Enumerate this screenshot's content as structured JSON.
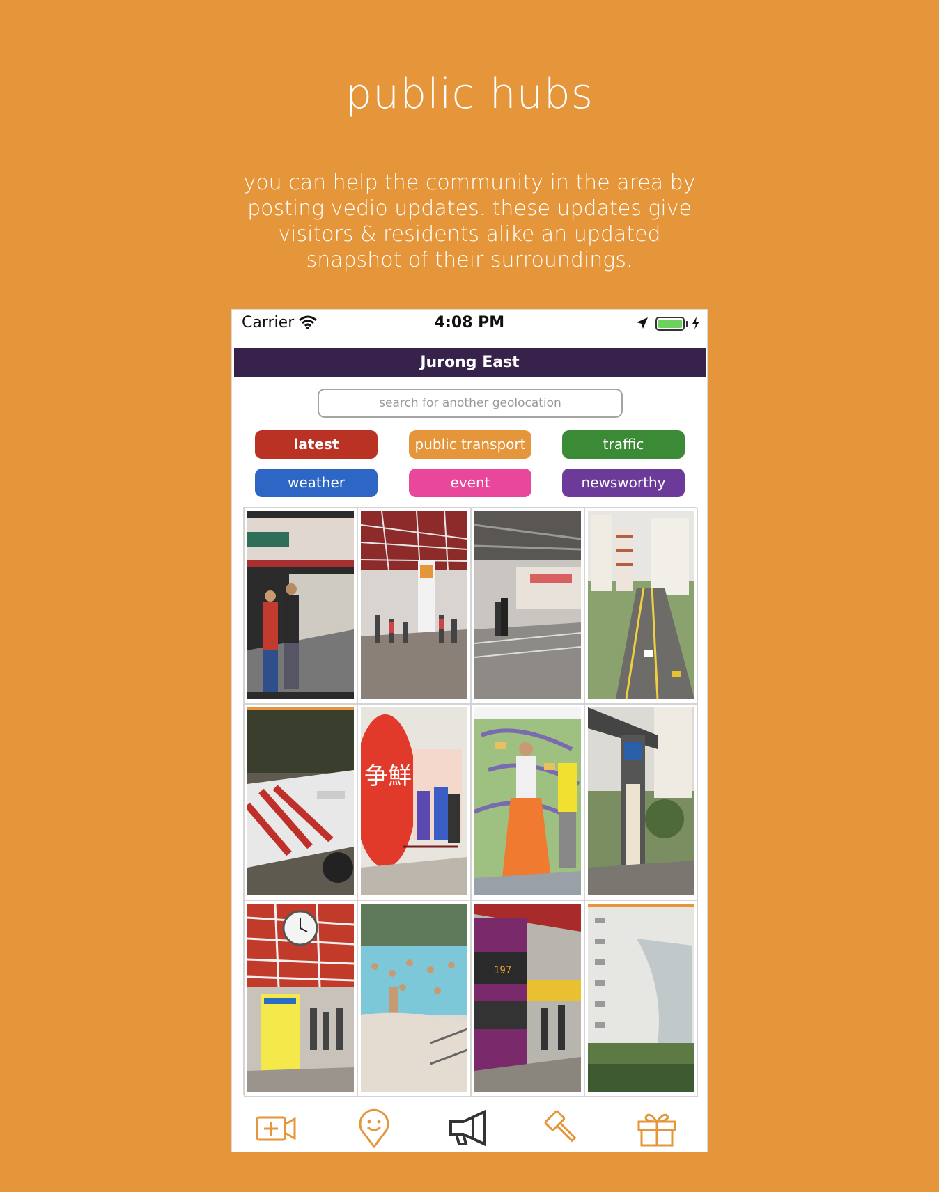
{
  "hero": {
    "title": "public hubs",
    "description": "you can help the community in the area by posting vedio updates. these updates give visitors & residents alike an updated snapshot of their surroundings."
  },
  "status_bar": {
    "carrier": "Carrier",
    "time": "4:08 PM",
    "icons": [
      "wifi-icon",
      "location-arrow-icon",
      "battery-icon",
      "charging-bolt-icon"
    ]
  },
  "header": {
    "title": "Jurong East"
  },
  "search": {
    "placeholder": "search for another geolocation"
  },
  "filters": [
    {
      "label": "latest",
      "color": "#BA3223"
    },
    {
      "label": "public transport",
      "color": "#E5953A"
    },
    {
      "label": "traffic",
      "color": "#3A8A36"
    },
    {
      "label": "weather",
      "color": "#2D66C4"
    },
    {
      "label": "event",
      "color": "#E9479B"
    },
    {
      "label": "newsworthy",
      "color": "#6C3A98"
    }
  ],
  "tabbar": {
    "icons": [
      "video-add-icon",
      "location-smiley-icon",
      "megaphone-icon",
      "gavel-icon",
      "gift-icon"
    ],
    "accent": "#E5953A",
    "active_color": "#333333"
  },
  "colors": {
    "background": "#E5953A",
    "header": "#36224A"
  }
}
